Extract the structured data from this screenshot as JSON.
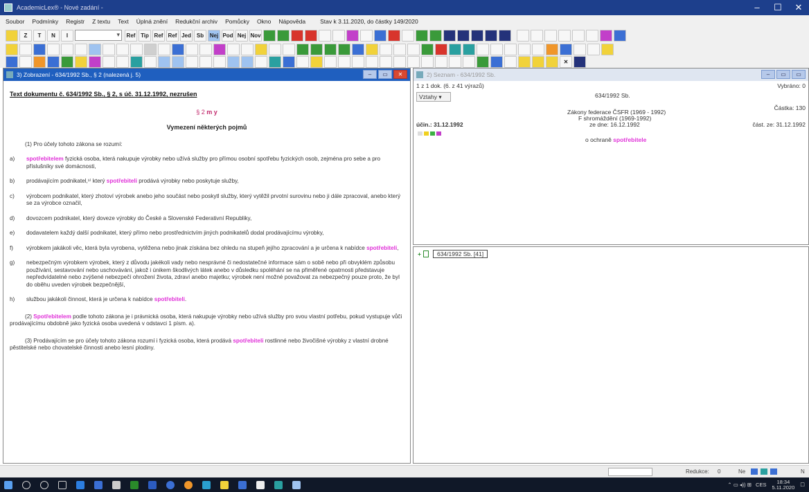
{
  "window": {
    "title": "AcademicLex® - Nové zadání -",
    "controls": [
      "–",
      "☐",
      "✕"
    ]
  },
  "menu": {
    "items": [
      "Soubor",
      "Podmínky",
      "Registr",
      "Z textu",
      "Text",
      "Úplná znění",
      "Redukční archiv",
      "Pomůcky",
      "Okno",
      "Nápověda"
    ],
    "status": "Stav k 3.11.2020, do částky 149/2020"
  },
  "toolbar1": [
    "Z",
    "T",
    "N",
    "I",
    "Ref",
    "Tip",
    "Ref",
    "Ref",
    "Jed",
    "Sb",
    "Nej",
    "Pod",
    "Nej",
    "Nov",
    "",
    "",
    "",
    "",
    "",
    "",
    "",
    "",
    "",
    "",
    "",
    "",
    "",
    "",
    "",
    "",
    "",
    ""
  ],
  "left_pane": {
    "title": "3) Zobrazení - 634/1992 Sb., § 2 (nalezená j. 5)",
    "doc_title": "Text dokumentu č. 634/1992 Sb., § 2, s úč. 31.12.1992, nezrušen",
    "section": "§ 2",
    "section_suffix": "m y",
    "heading": "Vymezení některých pojmů",
    "para1": "(1) Pro účely tohoto zákona se rozumí:",
    "items": [
      {
        "letter": "a)",
        "pre": "",
        "hl": "spotřebitelem",
        "post": " fyzická osoba, která nakupuje výrobky nebo užívá služby pro přímou osobní spotřebu fyzických osob, zejména pro sebe a pro příslušníky své domácnosti,"
      },
      {
        "letter": "b)",
        "pre": "prodávajícím podnikatel,¹⁾ který ",
        "hl": "spotřebiteli",
        "post": " prodává výrobky nebo poskytuje služby,"
      },
      {
        "letter": "c)",
        "pre": "výrobcem podnikatel, který zhotoví výrobek anebo jeho součást nebo poskytl služby, který vytěžil prvotní surovinu nebo ji dále zpracoval, anebo který se za výrobce označil,",
        "hl": "",
        "post": ""
      },
      {
        "letter": "d)",
        "pre": "dovozcem podnikatel, který doveze výrobky do České a Slovenské Federativní Republiky,",
        "hl": "",
        "post": ""
      },
      {
        "letter": "e)",
        "pre": "dodavatelem každý další podnikatel, který přímo nebo prostřednictvím jiných podnikatelů dodal prodávajícímu výrobky,",
        "hl": "",
        "post": ""
      },
      {
        "letter": "f)",
        "pre": "výrobkem jakákoli věc, která byla vyrobena, vytěžena nebo jinak získána bez ohledu na stupeň jejího zpracování a je určena k nabídce ",
        "hl": "spotřebiteli",
        "post": ","
      },
      {
        "letter": "g)",
        "pre": "nebezpečným výrobkem výrobek, který z důvodu jakékoli vady nebo nesprávné či nedostatečné informace sám o sobě nebo při obvyklém způsobu používání, sestavování nebo uschovávání, jakož i únikem škodlivých látek anebo v důsledku spoléhání se na přiměřené opatrnosti představuje nepředvídatelné nebo zvýšené nebezpečí ohrožení života, zdraví anebo majetku; výrobek není možné považovat za nebezpečný pouze proto, že byl do oběhu uveden výrobek bezpečnější,",
        "hl": "",
        "post": ""
      },
      {
        "letter": "h)",
        "pre": "službou jakákoli činnost, která je určena k nabídce ",
        "hl": "spotřebiteli",
        "post": "."
      }
    ],
    "para2_pre": "(2) ",
    "para2_hl": "Spotřebitelem",
    "para2_post": " podle tohoto zákona je i právnická osoba, která nakupuje výrobky nebo užívá služby pro svou vlastní potřebu, pokud vystupuje vůči prodávajícímu obdobně jako fyzická osoba uvedená v odstavci 1 písm. a).",
    "para3_pre": "(3) Prodávajícím se pro účely tohoto zákona rozumí i fyzická osoba, která prodává ",
    "para3_hl": "spotřebiteli",
    "para3_post": " rostlinné nebo živočišné výrobky z vlastní drobné pěstitelské nebo chovatelské činnosti anebo lesní plodiny."
  },
  "right_pane": {
    "title": "2) Seznam - 634/1992 Sb.",
    "count": "1 z 1 dok. (6. z 41 výrazů)",
    "doc_number": "634/1992 Sb.",
    "selected": "Vybráno: 0",
    "castka": "Částka: 130",
    "vztahy": "Vztahy",
    "collection": "Zákony federace ČSFR (1969 - 1992)",
    "assembly": "F shromáždění (1969-1992)",
    "date": "ze dne: 16.12.1992",
    "effective": "účin.: 31.12.1992",
    "part_date": "část. ze: 31.12.1992",
    "subject_pre": "o ochraně ",
    "subject_hl": "spotřebitele"
  },
  "lower_pane": {
    "plus": "+",
    "item": "634/1992 Sb. [41]"
  },
  "statusbar": {
    "redukce_label": "Redukce:",
    "redukce_value": "0",
    "ne": "Ne",
    "n": "N"
  },
  "taskbar": {
    "lang": "CES",
    "time": "18:34",
    "date": "5.11.2020"
  }
}
